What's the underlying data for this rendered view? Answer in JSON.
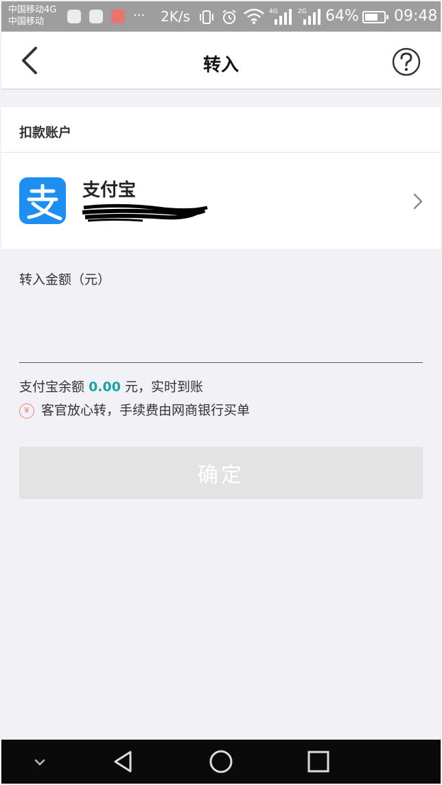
{
  "status_bar": {
    "carrier_line1": "中国移动4G",
    "carrier_line2": "中国移动",
    "dots": "···",
    "net_speed": "2K/s",
    "battery": "64%",
    "time": "09:48",
    "signal_4g": "4G",
    "signal_2g": "2G"
  },
  "nav": {
    "title": "转入"
  },
  "account": {
    "section_title": "扣款账户",
    "name": "支付宝"
  },
  "amount": {
    "label": "转入金额（元）",
    "input_value": "",
    "input_placeholder": ""
  },
  "balance": {
    "prefix": "支付宝余额",
    "value": "0.00",
    "suffix": "元，实时到账"
  },
  "fee_note": {
    "icon": "¥",
    "text": "客官放心转，手续费由网商银行买单"
  },
  "confirm_label": "确定",
  "colors": {
    "accent": "#1aa3a3",
    "alipay_blue": "#1e8ef0",
    "button_disabled": "#e3e3e3"
  }
}
